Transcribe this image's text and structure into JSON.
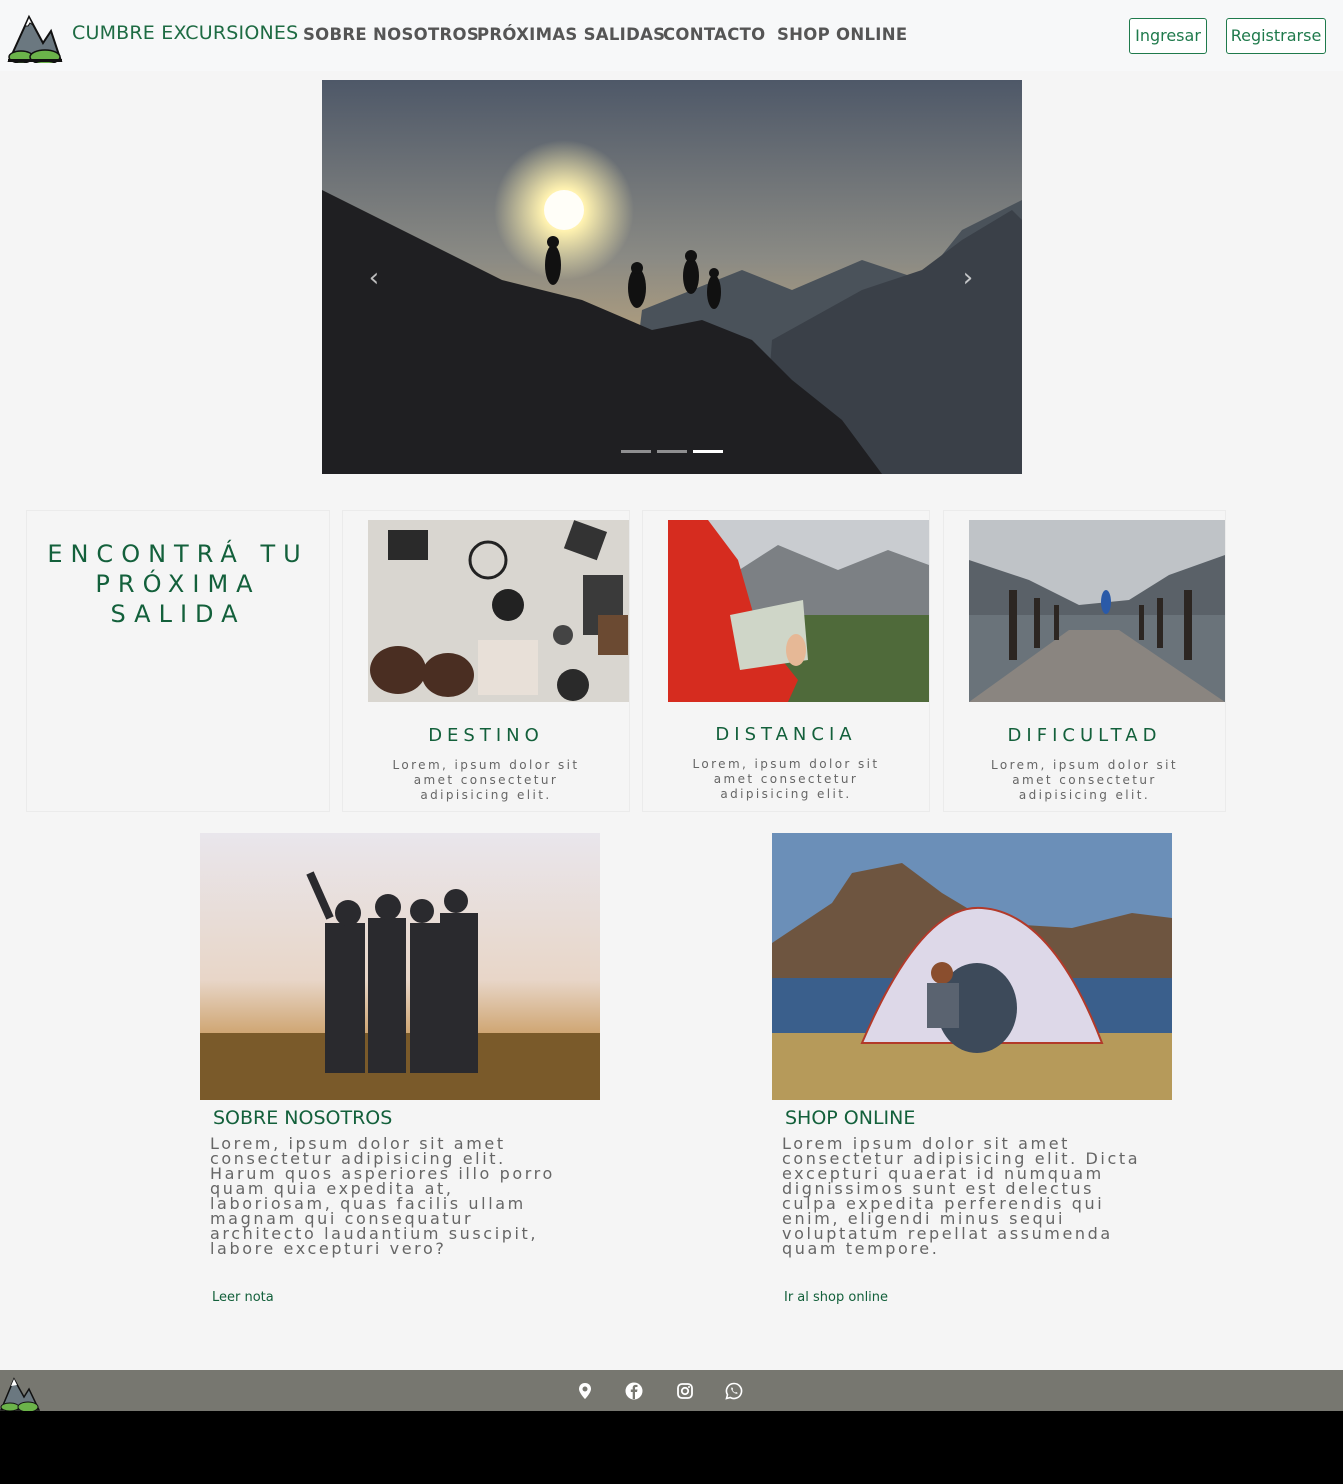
{
  "nav": {
    "brand": "CUMBRE EXCURSIONES",
    "links": [
      "SOBRE NOSOTROS",
      "PRÓXIMAS SALIDAS",
      "CONTACTO",
      "SHOP ONLINE"
    ],
    "login_label": "Ingresar",
    "register_label": "Registrarse"
  },
  "carousel": {
    "prev_glyph": "‹",
    "next_glyph": "›",
    "slide_count": 3,
    "active_slide": 3
  },
  "find": {
    "heading_line1": "ENCONTRÁ TU",
    "heading_line2": "PRÓXIMA",
    "heading_line3": "SALIDA",
    "cards": [
      {
        "title": "DESTINO",
        "text_l1": "Lorem, ipsum dolor sit",
        "text_l2": "amet consectetur",
        "text_l3": "adipisicing elit."
      },
      {
        "title": "DISTANCIA",
        "text_l1": "Lorem, ipsum dolor sit",
        "text_l2": "amet consectetur",
        "text_l3": "adipisicing elit."
      },
      {
        "title": "DIFICULTAD",
        "text_l1": "Lorem, ipsum dolor sit",
        "text_l2": "amet consectetur",
        "text_l3": "adipisicing elit."
      }
    ]
  },
  "features": [
    {
      "title": "SOBRE NOSOTROS",
      "text": "Lorem, ipsum dolor sit amet consectetur adipisicing elit. Harum quos asperiores illo porro quam quia expedita at, laboriosam, quas facilis ullam magnam qui consequatur architecto laudantium suscipit, labore excepturi vero?",
      "link": "Leer nota"
    },
    {
      "title": "SHOP ONLINE",
      "text": "Lorem ipsum dolor sit amet consectetur adipisicing elit. Dicta excepturi quaerat id numquam dignissimos sunt est delectus culpa expedita perferendis qui enim, eligendi minus sequi voluptatum repellat assumenda quam tempore.",
      "link": "Ir al shop online"
    }
  ],
  "footer": {
    "icons": [
      "map-pin-icon",
      "facebook-icon",
      "instagram-icon",
      "whatsapp-icon"
    ]
  },
  "colors": {
    "brand_green": "#13603b",
    "button_green": "#1f7a4c",
    "footer_gray": "#777770"
  }
}
